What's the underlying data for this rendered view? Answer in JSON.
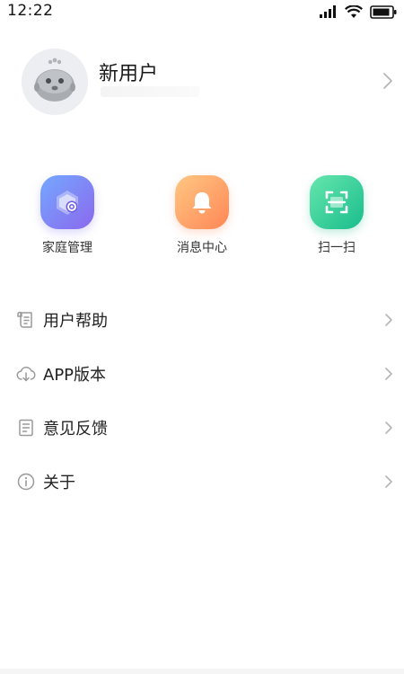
{
  "status_bar": {
    "time": "12:22",
    "icons": [
      "signal-icon",
      "wifi-icon",
      "battery-icon"
    ]
  },
  "profile": {
    "name": "新用户",
    "avatar_icon": "robot-avatar-icon",
    "chevron_icon": "chevron-right-icon"
  },
  "quick_actions": [
    {
      "label": "家庭管理",
      "icon": "home-settings-icon",
      "colors": [
        "#7aa4ff",
        "#8a6cf0"
      ]
    },
    {
      "label": "消息中心",
      "icon": "bell-icon",
      "colors": [
        "#ffc07a",
        "#ff8a5a"
      ]
    },
    {
      "label": "扫一扫",
      "icon": "scan-icon",
      "colors": [
        "#5fe3a6",
        "#1fbf8e"
      ]
    }
  ],
  "menu": [
    {
      "label": "用户帮助",
      "icon": "help-scroll-icon"
    },
    {
      "label": "APP版本",
      "icon": "cloud-download-icon"
    },
    {
      "label": "意见反馈",
      "icon": "feedback-document-icon"
    },
    {
      "label": "关于",
      "icon": "info-icon"
    }
  ],
  "colors": {
    "background": "#ffffff",
    "text_primary": "#222222",
    "icon_gray": "#9a9a9a",
    "chevron_gray": "#b5b5b5"
  }
}
